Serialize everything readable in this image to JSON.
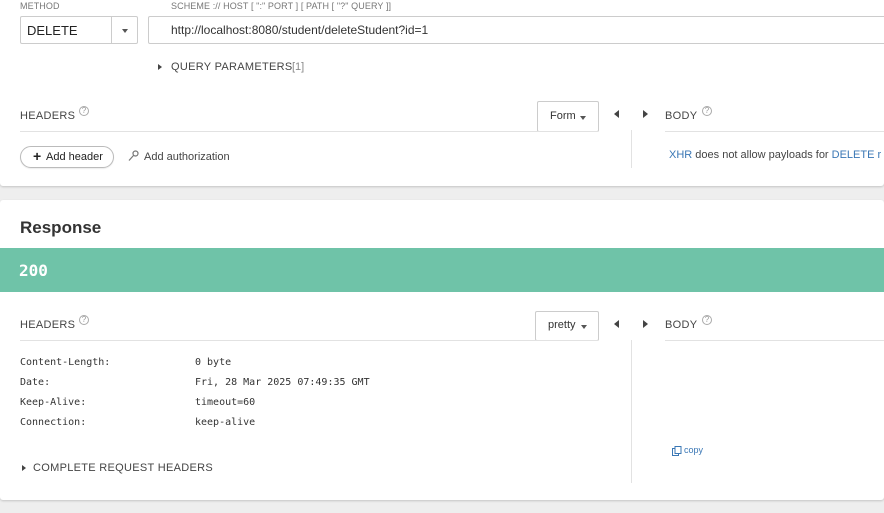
{
  "request": {
    "method_label": "METHOD",
    "method_value": "DELETE",
    "url_label": "SCHEME :// HOST [ \":\" PORT ] [ PATH [ \"?\" QUERY ]]",
    "url_value": "http://localhost:8080/student/deleteStudent?id=1",
    "query_params_label": "QUERY PARAMETERS",
    "query_params_count": "[1]",
    "headers_label": "HEADERS",
    "help_glyph": "?",
    "headers_mode": "Form",
    "add_header_label": "Add header",
    "add_auth_label": "Add authorization",
    "body_label": "BODY",
    "body_msg_xhr": "XHR",
    "body_msg_mid": " does not allow payloads for ",
    "body_msg_method": "DELETE",
    "body_msg_tail": " r"
  },
  "response": {
    "title": "Response",
    "status_code": "200",
    "status_color": "#6fc3a8",
    "headers_label": "HEADERS",
    "help_glyph": "?",
    "format_value": "pretty",
    "body_label": "BODY",
    "headers": [
      {
        "name": "Content-Length:",
        "value": "0 byte"
      },
      {
        "name": "Date:",
        "value": "Fri, 28 Mar 2025 07:49:35 GMT"
      },
      {
        "name": "Keep-Alive:",
        "value": "timeout=60"
      },
      {
        "name": "Connection:",
        "value": "keep-alive"
      }
    ],
    "complete_headers_label": "COMPLETE REQUEST HEADERS",
    "copy_label": "copy"
  },
  "colors": {
    "link": "#3a77b5",
    "background": "#eeeeee"
  }
}
